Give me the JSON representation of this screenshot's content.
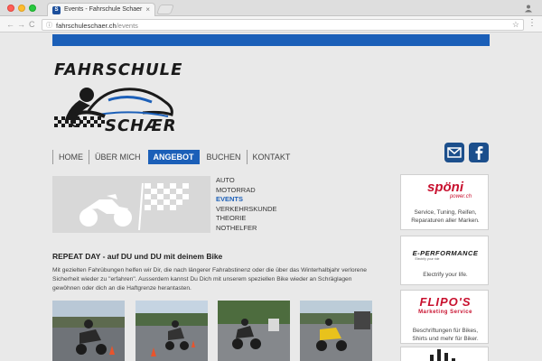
{
  "browser": {
    "tab_title": "Events - Fahrschule Schaer",
    "tab_close": "×",
    "url_host": "fahrschuleschaer.ch",
    "url_path": "/events",
    "nav_back": "←",
    "nav_forward": "→",
    "nav_reload": "C",
    "info_icon": "ⓘ",
    "star_icon": "☆",
    "menu_icon": "⋮"
  },
  "logo": {
    "top_word": "FAHRSCHULE",
    "bottom_word": "SCHÆR",
    "brand_color": "#1b5fb8"
  },
  "nav": {
    "items": [
      {
        "label": "HOME"
      },
      {
        "label": "ÜBER MICH"
      },
      {
        "label": "ANGEBOT"
      },
      {
        "label": "BUCHEN"
      },
      {
        "label": "KONTAKT"
      }
    ],
    "active": "ANGEBOT"
  },
  "social": {
    "mail_icon": "mail-icon",
    "facebook_icon": "facebook-icon",
    "color": "#1c4f8c"
  },
  "subnav": {
    "items": [
      {
        "label": "AUTO"
      },
      {
        "label": "MOTORRAD"
      },
      {
        "label": "EVENTS"
      },
      {
        "label": "VERKEHRSKUNDE"
      },
      {
        "label": "THEORIE"
      },
      {
        "label": "NOTHELFER"
      }
    ],
    "active": "EVENTS"
  },
  "article": {
    "title": "REPEAT DAY - auf DU und DU mit deinem Bike",
    "body": "Mit gezielten Fahrübungen helfen wir Dir, die nach längerer Fahrabstinenz oder die über das Winterhalbjahr verlorene Sicherheit wieder zu \"erfahren\". Ausserdem kannst Du Dich mit unserem speziellen Bike wieder an Schräglagen gewöhnen oder dich an die Haftgrenze herantasten."
  },
  "sidebar": {
    "ads": [
      {
        "logo_main": "spöni",
        "logo_sub": "power.ch",
        "text": "Service, Tuning, Reifen, Reparaturen aller Marken."
      },
      {
        "logo_main": "E-PERFORMANCE",
        "logo_sub": "Electrify your ride",
        "text": "Electrify your life."
      },
      {
        "logo_main": "FLIPO'S",
        "logo_sub": "Marketing Service",
        "text": "Beschriftungen für Bikes, Shirts und mehr für Biker."
      }
    ]
  }
}
